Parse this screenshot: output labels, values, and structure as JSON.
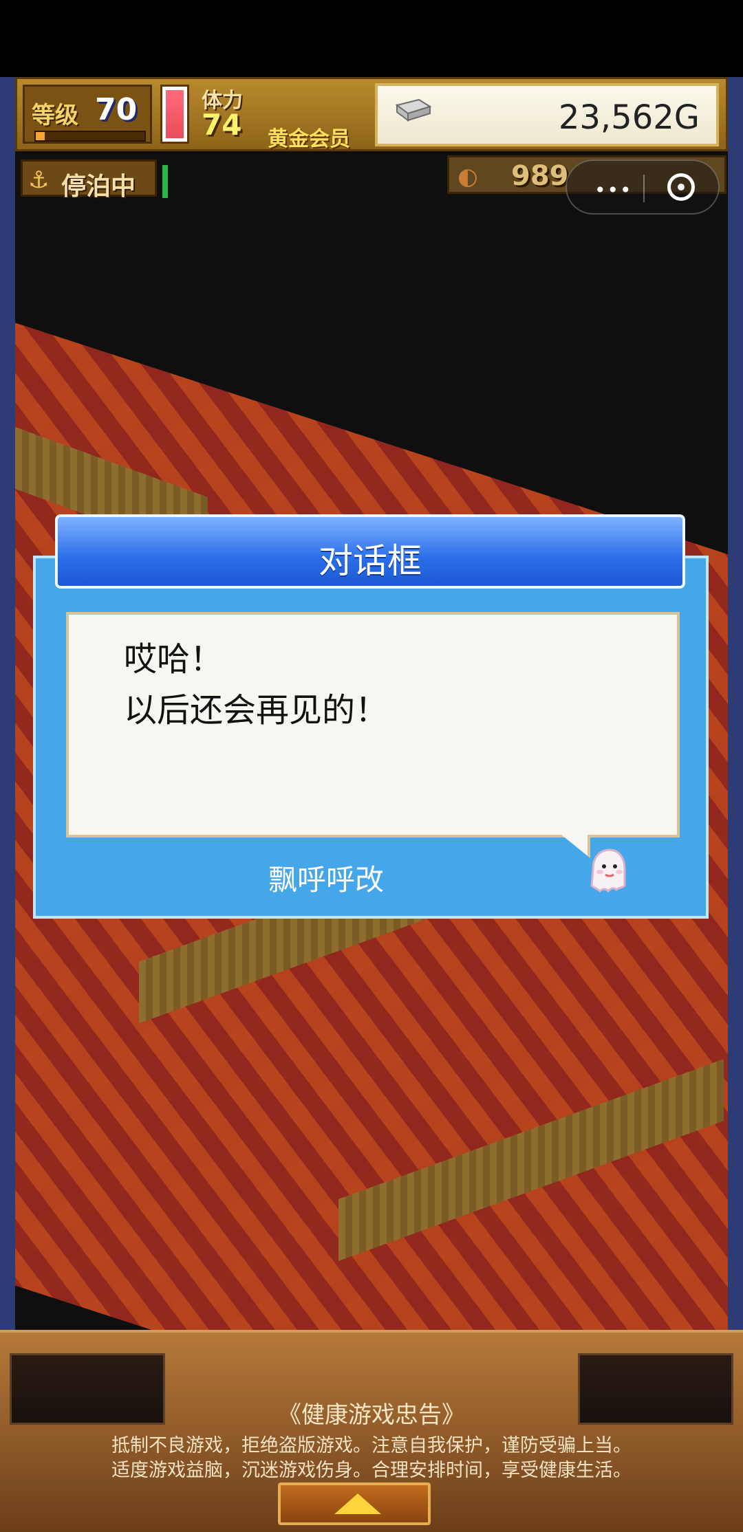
{
  "hud": {
    "level_label": "等级",
    "level_value": "70",
    "stamina_label": "体力",
    "stamina_value": "74",
    "member_status": "黄金会员",
    "gold_value": "23,562G",
    "anchor_status": "停泊中",
    "resource_value": "989"
  },
  "miniapp": {
    "more_icon": "more-dots-icon",
    "close_icon": "target-close-icon"
  },
  "dialog": {
    "title": "对话框",
    "message": "哎哈！\n以后还会再见的！",
    "speaker": "飘呼呼改"
  },
  "notice": {
    "title": "《健康游戏忠告》",
    "line1": "抵制不良游戏，拒绝盗版游戏。注意自我保护，谨防受骗上当。",
    "line2": "适度游戏益脑，沉迷游戏伤身。合理安排时间，享受健康生活。"
  },
  "colors": {
    "dialog_blue": "#2b6ee8",
    "panel_gold": "#b98b2e",
    "bottom_wood": "#8c5524"
  }
}
